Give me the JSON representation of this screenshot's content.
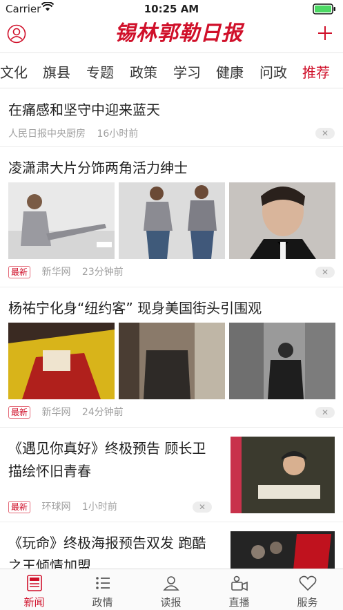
{
  "status": {
    "carrier": "Carrier",
    "time": "10:25 AM"
  },
  "header": {
    "logo": "锡林郭勒日报"
  },
  "tabs": [
    "文化",
    "旗县",
    "专题",
    "政策",
    "学习",
    "健康",
    "问政",
    "推荐"
  ],
  "news": [
    {
      "title": "在痛感和坚守中迎来蓝天",
      "source": "人民日报中央厨房",
      "time": "16小时前",
      "badge": ""
    },
    {
      "title": "凌潇肃大片分饰两角活力绅士",
      "source": "新华网",
      "time": "23分钟前",
      "badge": "最新"
    },
    {
      "title": "杨祐宁化身“纽约客” 现身美国街头引围观",
      "source": "新华网",
      "time": "24分钟前",
      "badge": "最新"
    },
    {
      "title_line1": "《遇见你真好》终极预告 顾长卫",
      "title_line2": "描绘怀旧青春",
      "source": "环球网",
      "time": "1小时前",
      "badge": "最新"
    },
    {
      "title_line1": "《玩命》终极海报预告双发 跑酷",
      "title_line2": "之王倾情加盟"
    }
  ],
  "dismiss_label": "✕",
  "bottom_nav": [
    {
      "label": "新闻",
      "icon": "newspaper-icon"
    },
    {
      "label": "政情",
      "icon": "list-icon"
    },
    {
      "label": "读报",
      "icon": "reader-icon"
    },
    {
      "label": "直播",
      "icon": "live-camera-icon"
    },
    {
      "label": "服务",
      "icon": "heart-icon"
    }
  ],
  "colors": {
    "accent": "#d0102a"
  }
}
